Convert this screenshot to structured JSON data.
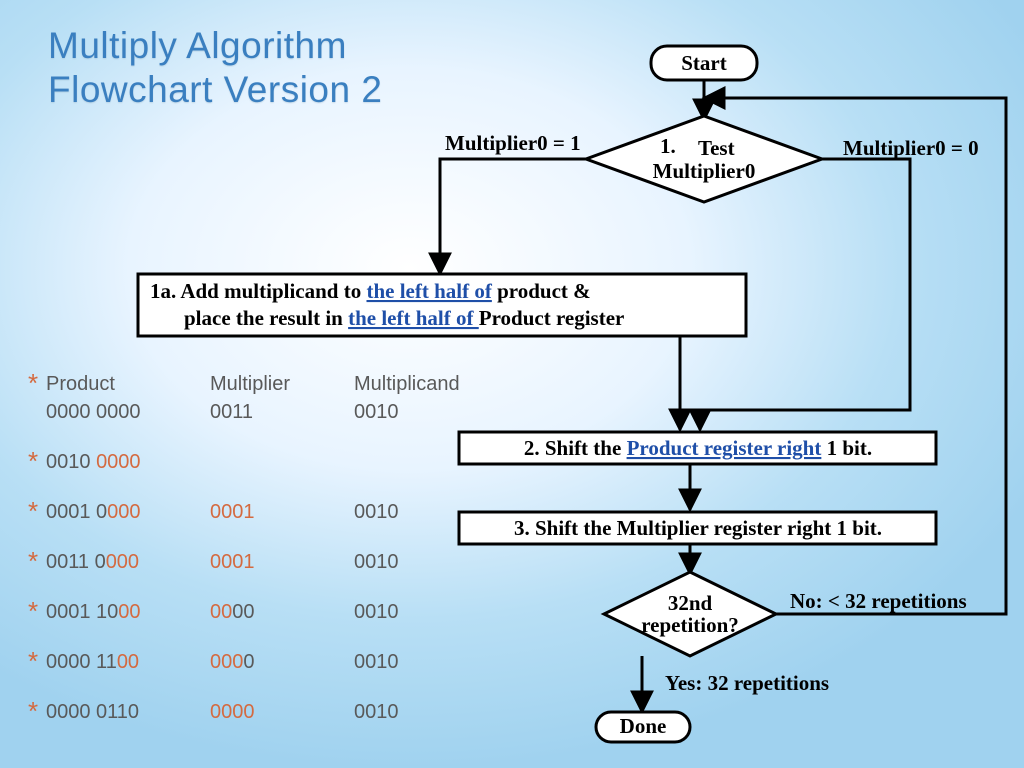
{
  "title_line1": "Multiply Algorithm",
  "title_line2": "Flowchart Version 2",
  "nodes": {
    "start": "Start",
    "test1": "1.",
    "test2": "Test",
    "test3": "Multiplier0",
    "label_eq1": "Multiplier0 = 1",
    "label_eq0": "Multiplier0 = 0",
    "step1a_a": "1a. Add multiplicand to ",
    "step1a_b": "the left half of",
    "step1a_c": " product &",
    "step1a_d": "place the result in ",
    "step1a_e": "the left half of ",
    "step1a_f": "Product register",
    "step2_a": "2. Shift the ",
    "step2_b": "Product register right",
    "step2_c": " 1 bit.",
    "step3": "3. Shift the Multiplier register right 1 bit.",
    "rep1": "32nd",
    "rep2": "repetition?",
    "no_label": "No: < 32 repetitions",
    "yes_label": "Yes: 32 repetitions",
    "done": "Done"
  },
  "table": {
    "headers": [
      "Product",
      "Multiplier",
      "Multiplicand"
    ],
    "rows": [
      {
        "c1a": "0000 0000",
        "c1b": "",
        "c2a": "0011",
        "c2b": "",
        "c3": "0010"
      },
      {
        "c1a": "0010 ",
        "c1b": "0000",
        "c2a": "",
        "c2b": "",
        "c3": ""
      },
      {
        "c1a": "0001 0",
        "c1b": "000",
        "c2a": "",
        "c2b": "0001",
        "c3": "0010"
      },
      {
        "c1a": "0011 0",
        "c1b": "000",
        "c2a": "",
        "c2b": "0001",
        "c3": "0010"
      },
      {
        "c1a": "0001 10",
        "c1b": "00",
        "c2a": "",
        "c2b": "0000",
        "c3": "0010"
      },
      {
        "c1a": "0000 11",
        "c1b": "00",
        "c2a": "",
        "c2b": "0000",
        "c3": "0010"
      },
      {
        "c1a": "0000 0110",
        "c1b": "",
        "c2a": "",
        "c2b": "0000",
        "c3": "0010"
      }
    ]
  }
}
